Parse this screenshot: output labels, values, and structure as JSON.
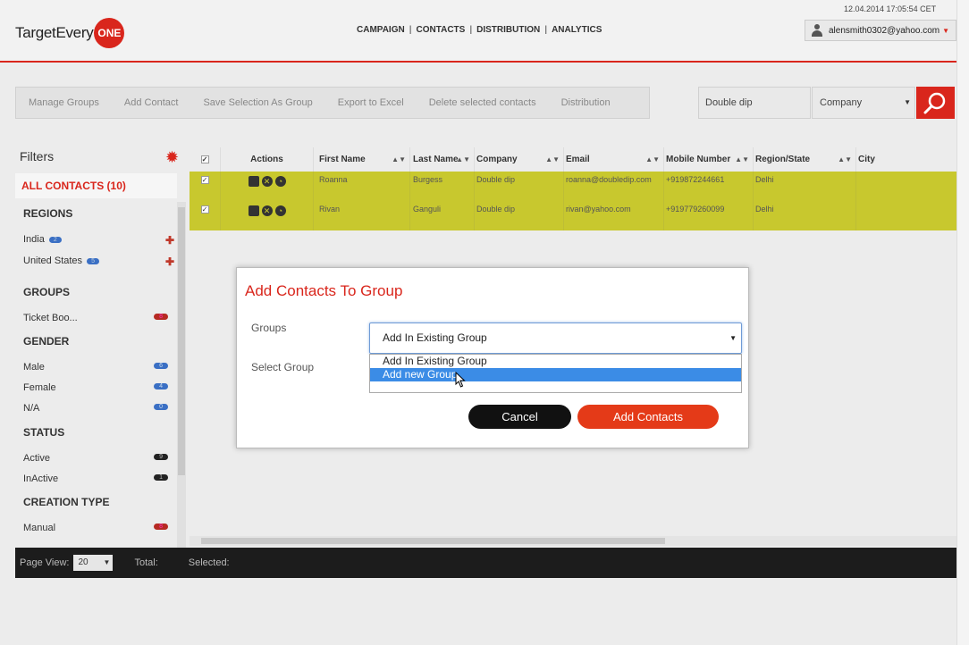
{
  "header": {
    "logo_text": "TargetEvery",
    "logo_badge": "ONE",
    "nav": [
      "CAMPAIGN",
      "CONTACTS",
      "DISTRIBUTION",
      "ANALYTICS"
    ],
    "datetime": "12.04.2014 17:05:54 CET",
    "user_email": "alensmith0302@yahoo.com"
  },
  "toolbar": {
    "buttons": [
      "Manage Groups",
      "Add Contact",
      "Save Selection As Group",
      "Export to Excel",
      "Delete selected contacts",
      "Distribution"
    ],
    "search_value": "Double dip",
    "search_field": "Company"
  },
  "sidebar": {
    "title": "Filters",
    "all_contacts": "ALL CONTACTS (10)",
    "sections": {
      "regions": "REGIONS",
      "groups": "GROUPS",
      "gender": "GENDER",
      "status": "STATUS",
      "creation_type": "CREATION TYPE"
    },
    "regions": [
      {
        "label": "India",
        "count": "2"
      },
      {
        "label": "United States",
        "count": "5"
      }
    ],
    "groups": [
      {
        "label": "Ticket Boo...",
        "count": "8"
      }
    ],
    "gender": [
      {
        "label": "Male",
        "count": "6"
      },
      {
        "label": "Female",
        "count": "4"
      },
      {
        "label": "N/A",
        "count": "0"
      }
    ],
    "status": [
      {
        "label": "Active",
        "count": "9"
      },
      {
        "label": "InActive",
        "count": "1"
      }
    ],
    "creation_type": [
      {
        "label": "Manual",
        "count": "8"
      }
    ]
  },
  "table": {
    "headers": [
      "Actions",
      "First Name",
      "Last Name",
      "Company",
      "Email",
      "Mobile Number",
      "Region/State",
      "City"
    ],
    "rows": [
      {
        "first": "Roanna",
        "last": "Burgess",
        "company": "Double dip",
        "email": "roanna@doubledip.com",
        "mobile": "+919872244661",
        "region": "Delhi",
        "city": ""
      },
      {
        "first": "Rivan",
        "last": "Ganguli",
        "company": "Double dip",
        "email": "rivan@yahoo.com",
        "mobile": "+919779260099",
        "region": "Delhi",
        "city": ""
      }
    ]
  },
  "footer": {
    "page_view_label": "Page View:",
    "page_view_value": "20",
    "total_label": "Total:",
    "selected_label": "Selected:"
  },
  "modal": {
    "title": "Add Contacts To Group",
    "groups_label": "Groups",
    "select_group_label": "Select Group",
    "selected_option": "Add In Existing Group",
    "options": [
      "Add In Existing Group",
      "Add new Group"
    ],
    "cancel_label": "Cancel",
    "add_label": "Add Contacts"
  },
  "colors": {
    "accent": "#d9261c",
    "row_highlight": "#c8c82e",
    "option_highlight": "#3b8ce6"
  }
}
